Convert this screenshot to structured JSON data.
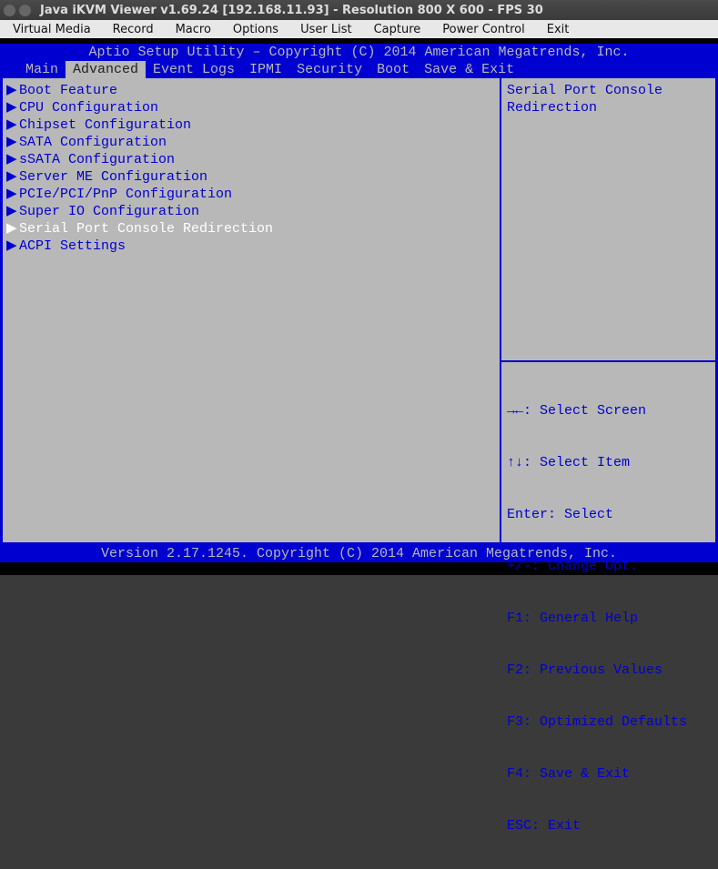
{
  "window": {
    "title": "Java iKVM Viewer v1.69.24 [192.168.11.93]  - Resolution 800 X 600 - FPS 30"
  },
  "menubar": {
    "items": [
      "Virtual Media",
      "Record",
      "Macro",
      "Options",
      "User List",
      "Capture",
      "Power Control",
      "Exit"
    ]
  },
  "bios": {
    "header": "Aptio Setup Utility – Copyright (C) 2014 American Megatrends, Inc.",
    "footer": "Version 2.17.1245. Copyright (C) 2014 American Megatrends, Inc.",
    "tabs": [
      "Main",
      "Advanced",
      "Event Logs",
      "IPMI",
      "Security",
      "Boot",
      "Save & Exit"
    ],
    "active_tab_index": 1,
    "menu_items": [
      "Boot Feature",
      "CPU Configuration",
      "Chipset Configuration",
      "SATA Configuration",
      "sSATA Configuration",
      "Server ME Configuration",
      "PCIe/PCI/PnP Configuration",
      "Super IO Configuration",
      "Serial Port Console Redirection",
      "ACPI Settings"
    ],
    "selected_index": 8,
    "help_text": "Serial Port Console\nRedirection",
    "legend": [
      "→←: Select Screen",
      "↑↓: Select Item",
      "Enter: Select",
      "+/-: Change Opt.",
      "F1: General Help",
      "F2: Previous Values",
      "F3: Optimized Defaults",
      "F4: Save & Exit",
      "ESC: Exit"
    ]
  }
}
